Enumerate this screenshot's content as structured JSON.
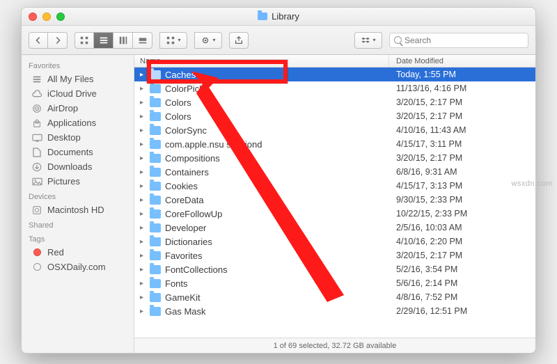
{
  "window": {
    "title": "Library"
  },
  "toolbar": {
    "search_placeholder": "Search"
  },
  "columns": {
    "name": "Name",
    "date": "Date Modified"
  },
  "sidebar": {
    "groups": [
      {
        "label": "Favorites",
        "items": [
          {
            "icon": "all-my-files-icon",
            "label": "All My Files"
          },
          {
            "icon": "cloud-icon",
            "label": "iCloud Drive"
          },
          {
            "icon": "airdrop-icon",
            "label": "AirDrop"
          },
          {
            "icon": "applications-icon",
            "label": "Applications"
          },
          {
            "icon": "desktop-icon",
            "label": "Desktop"
          },
          {
            "icon": "documents-icon",
            "label": "Documents"
          },
          {
            "icon": "downloads-icon",
            "label": "Downloads"
          },
          {
            "icon": "pictures-icon",
            "label": "Pictures"
          }
        ]
      },
      {
        "label": "Devices",
        "items": [
          {
            "icon": "disk-icon",
            "label": "Macintosh HD"
          }
        ]
      },
      {
        "label": "Shared",
        "items": []
      },
      {
        "label": "Tags",
        "items": [
          {
            "icon": "tag-red",
            "label": "Red"
          },
          {
            "icon": "tag-empty",
            "label": "OSXDaily.com"
          }
        ]
      }
    ]
  },
  "files": [
    {
      "name": "Caches",
      "date": "Today, 1:55 PM",
      "selected": true
    },
    {
      "name": "ColorPick",
      "date": "11/13/16, 4:16 PM"
    },
    {
      "name": "Colors",
      "date": "3/20/15, 2:17 PM"
    },
    {
      "name": "Colors",
      "date": "3/20/15, 2:17 PM"
    },
    {
      "name": "ColorSync",
      "date": "4/10/16, 11:43 AM"
    },
    {
      "name": "com.apple.nsu    sessiond",
      "date": "4/15/17, 3:11 PM"
    },
    {
      "name": "Compositions",
      "date": "3/20/15, 2:17 PM"
    },
    {
      "name": "Containers",
      "date": "6/8/16, 9:31 AM"
    },
    {
      "name": "Cookies",
      "date": "4/15/17, 3:13 PM"
    },
    {
      "name": "CoreData",
      "date": "9/30/15, 2:33 PM"
    },
    {
      "name": "CoreFollowUp",
      "date": "10/22/15, 2:33 PM"
    },
    {
      "name": "Developer",
      "date": "2/5/16, 10:03 AM"
    },
    {
      "name": "Dictionaries",
      "date": "4/10/16, 2:20 PM"
    },
    {
      "name": "Favorites",
      "date": "3/20/15, 2:17 PM"
    },
    {
      "name": "FontCollections",
      "date": "5/2/16, 3:54 PM"
    },
    {
      "name": "Fonts",
      "date": "5/6/16, 2:14 PM"
    },
    {
      "name": "GameKit",
      "date": "4/8/16, 7:52 PM"
    },
    {
      "name": "Gas Mask",
      "date": "2/29/16, 12:51 PM"
    }
  ],
  "status": {
    "text": "1 of 69 selected, 32.72 GB available"
  },
  "watermark": "wsxdn.com"
}
